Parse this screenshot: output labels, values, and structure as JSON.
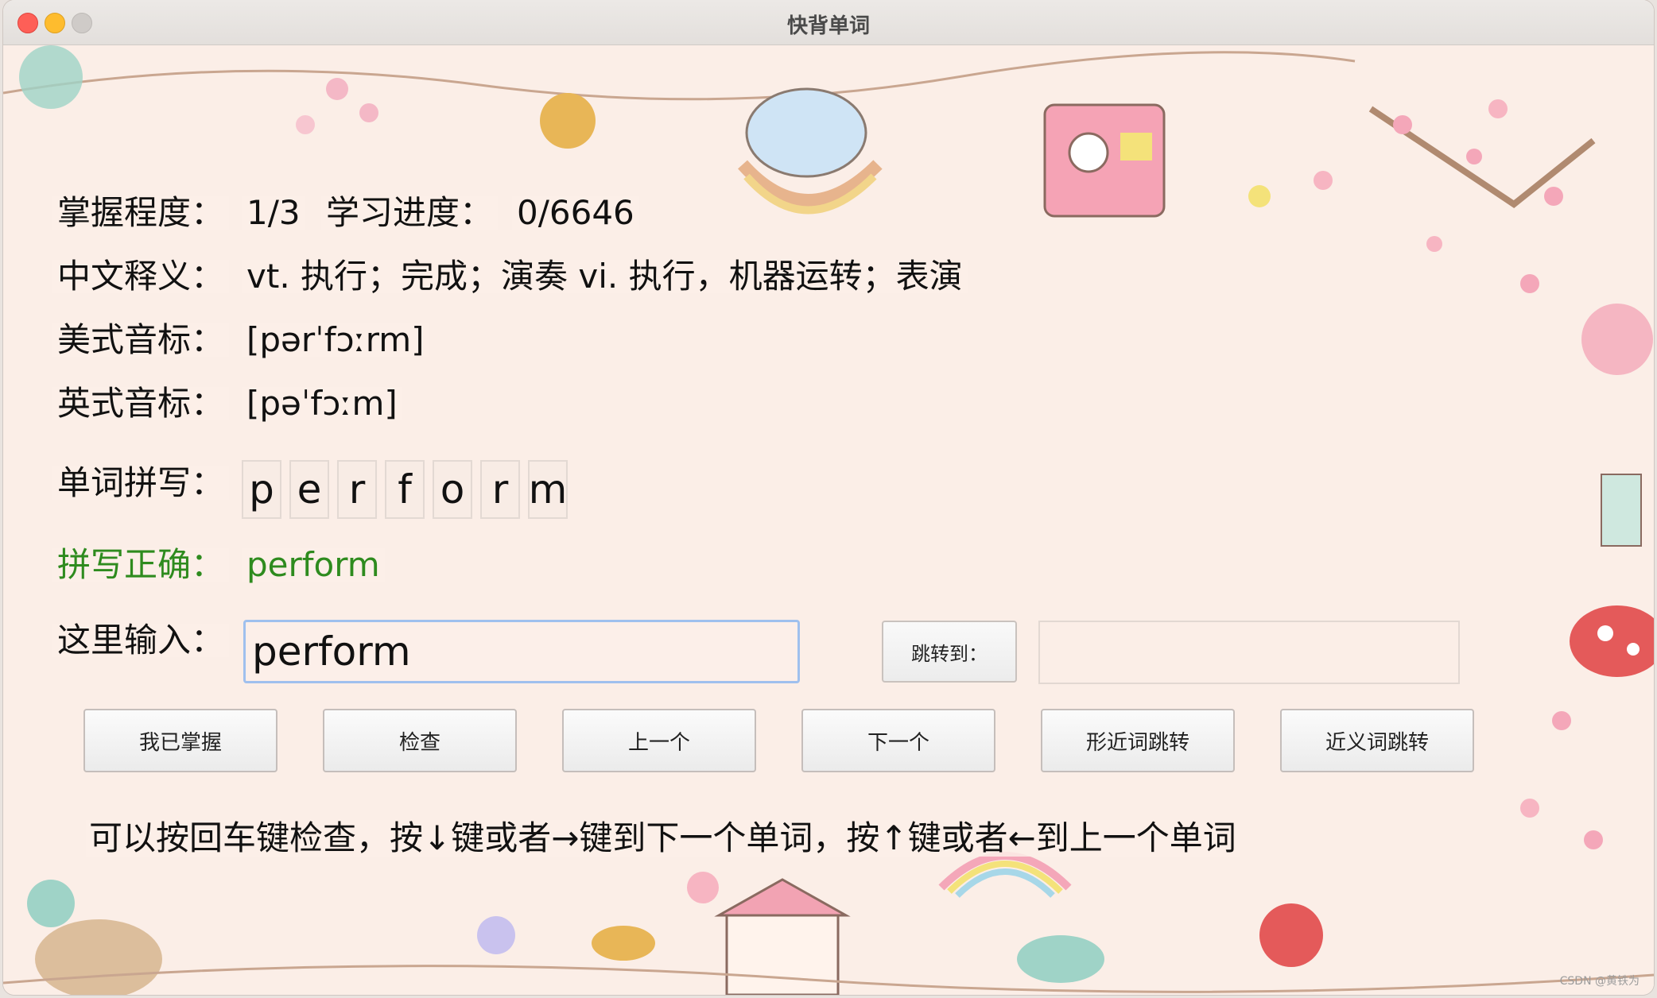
{
  "window": {
    "title": "快背单词"
  },
  "labels": {
    "mastery": "掌握程度：",
    "progress": "学习进度：",
    "meaning": "中文释义：",
    "us_phonetic": "美式音标：",
    "uk_phonetic": "英式音标：",
    "spelling": "单词拼写：",
    "correct": "拼写正确：",
    "input": "这里输入："
  },
  "values": {
    "mastery": "1/3",
    "progress": "0/6646",
    "meaning": "vt. 执行；完成；演奏 vi. 执行，机器运转；表演",
    "us_phonetic": "[pərˈfɔːrm]",
    "uk_phonetic": "[pəˈfɔːm]",
    "letters": [
      "p",
      "e",
      "r",
      "f",
      "o",
      "r",
      "m"
    ],
    "correct_word": "perform",
    "input_value": "perform"
  },
  "jump": {
    "button_label": "跳转到：",
    "input_value": ""
  },
  "buttons": {
    "mastered": "我已掌握",
    "check": "检查",
    "prev": "上一个",
    "next": "下一个",
    "similar_form": "形近词跳转",
    "synonym": "近义词跳转"
  },
  "hint": "可以按回车键检查，按↓键或者→键到下一个单词，按↑键或者←到上一个单词",
  "watermark": "CSDN @黄铁为",
  "colors": {
    "correct": "#2e8b1e",
    "focus_border": "#9fc0ee",
    "background": "#fbeee7"
  }
}
